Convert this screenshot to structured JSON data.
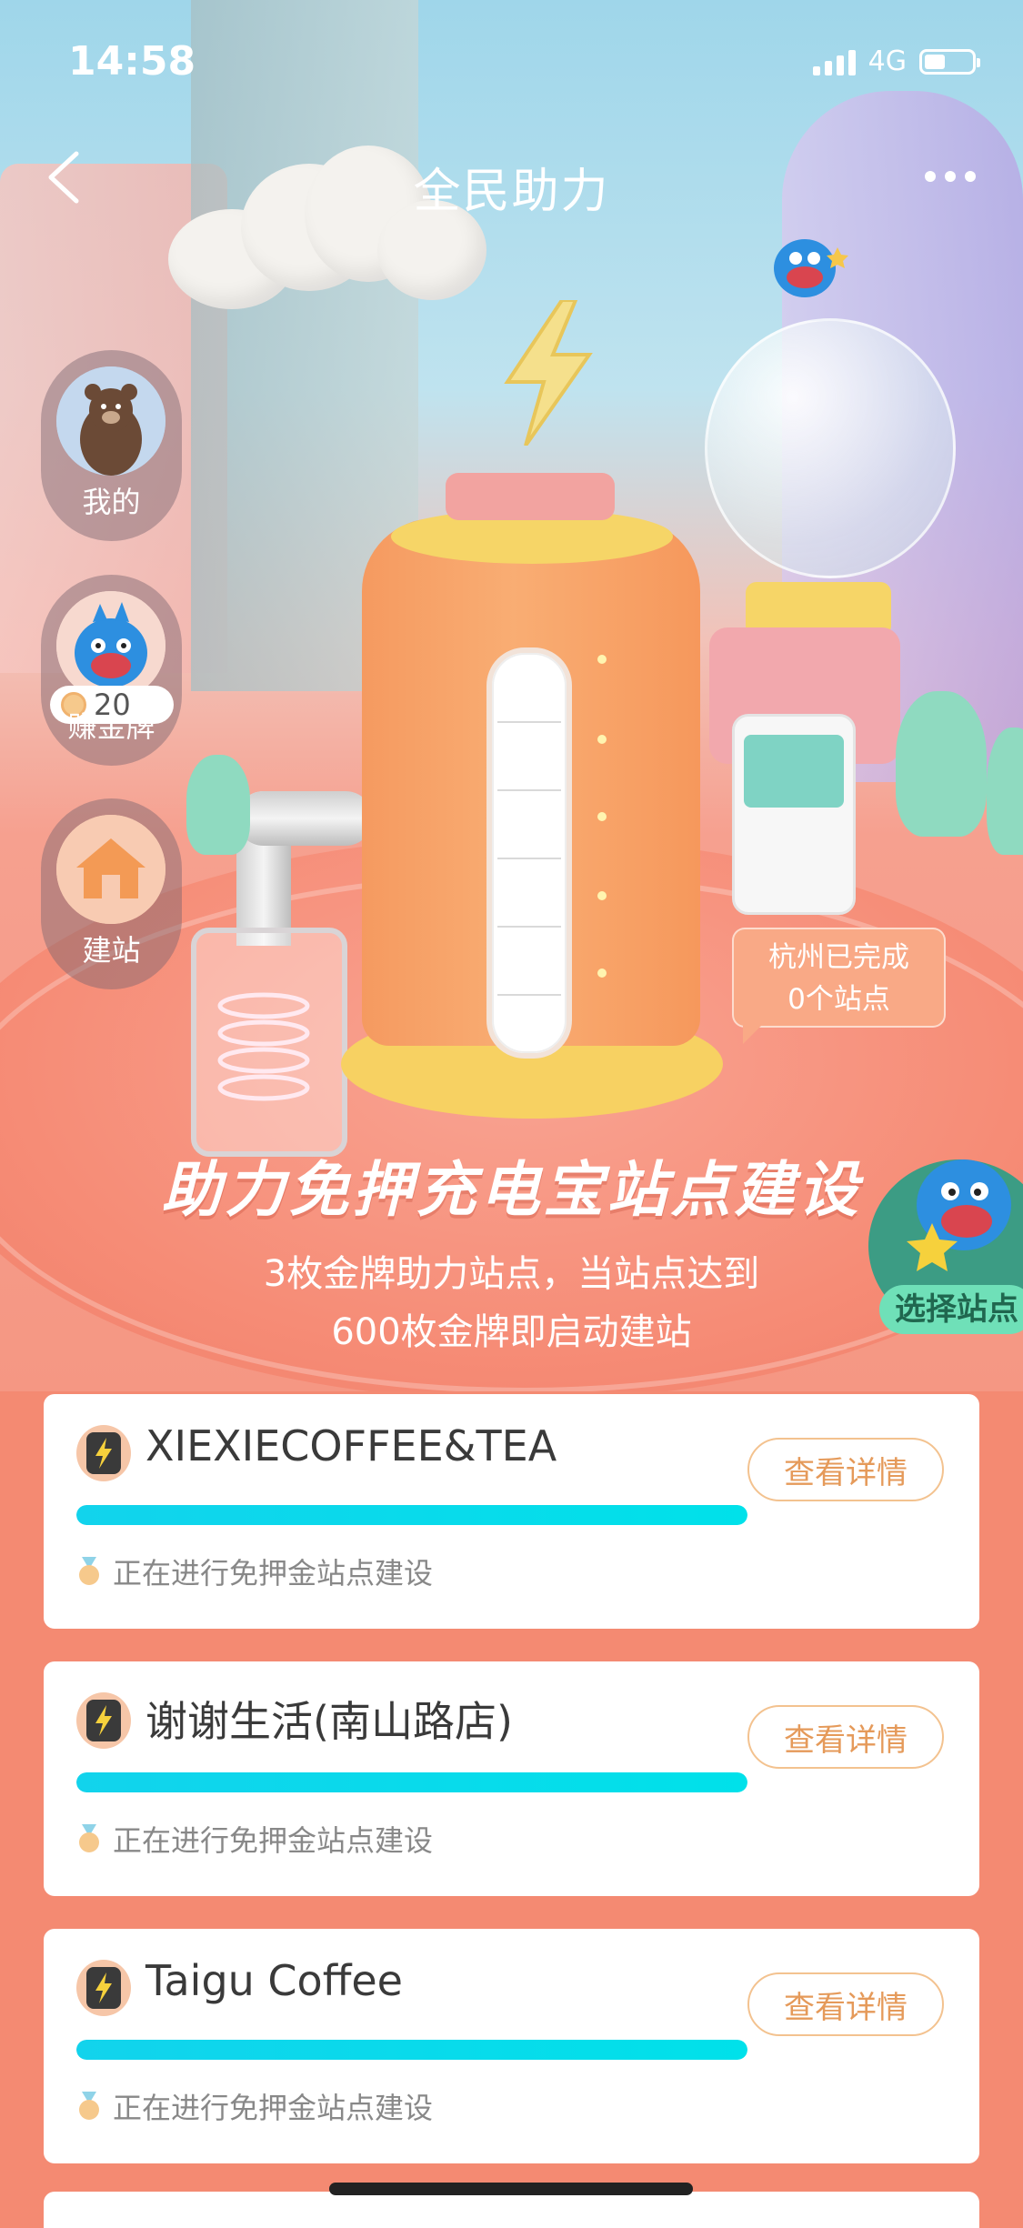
{
  "status_bar": {
    "time": "14:58",
    "network": "4G"
  },
  "nav": {
    "title": "全民助力",
    "back_icon": "chevron-left-icon",
    "more_icon": "more-dots-icon"
  },
  "side_buttons": [
    {
      "label": "我的",
      "icon": "bear-avatar-icon"
    },
    {
      "label": "赚金牌",
      "icon": "blue-monster-icon",
      "badge_count": "20"
    },
    {
      "label": "建站",
      "icon": "house-icon"
    }
  ],
  "city_progress": {
    "line1": "杭州已完成",
    "line2": "0个站点"
  },
  "hero": {
    "heading": "助力免押充电宝站点建设",
    "subtitle_line1": "3枚金牌助力站点，当站点达到",
    "subtitle_line2": "600枚金牌即启动建站"
  },
  "select_site": {
    "label": "选择站点"
  },
  "stations": [
    {
      "name": "XIEXIECOFFEE&TEA",
      "progress": 1.0,
      "status": "正在进行免押金站点建设",
      "button": "查看详情"
    },
    {
      "name": "谢谢生活(南山路店)",
      "progress": 1.0,
      "status": "正在进行免押金站点建设",
      "button": "查看详情"
    },
    {
      "name": "Taigu Coffee",
      "progress": 1.0,
      "status": "正在进行免押金站点建设",
      "button": "查看详情"
    }
  ],
  "colors": {
    "accent": "#00dceb",
    "button_border": "#f3c28f",
    "button_text": "#e59a5a",
    "page_bg": "#f48a72"
  }
}
